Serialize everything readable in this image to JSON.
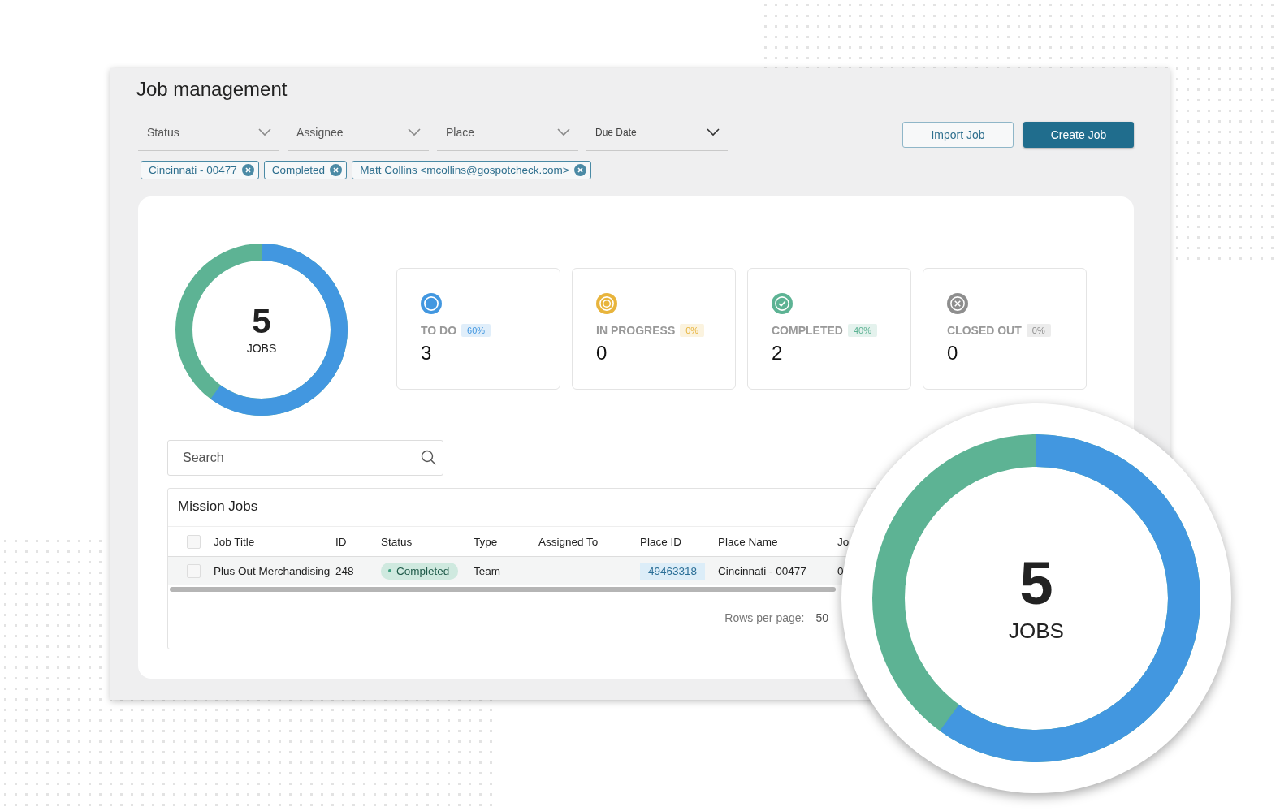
{
  "window": {
    "title": "Job management"
  },
  "filters": [
    {
      "label": "Status",
      "kind": "normal"
    },
    {
      "label": "Assignee",
      "kind": "normal"
    },
    {
      "label": "Place",
      "kind": "normal"
    },
    {
      "label": "Due Date",
      "kind": "small"
    }
  ],
  "buttons": [
    {
      "label": "Import Job",
      "kind": "secondary"
    },
    {
      "label": "Create Job",
      "kind": "primary"
    }
  ],
  "chips": [
    {
      "label": "Cincinnati - 00477"
    },
    {
      "label": "Completed"
    },
    {
      "label": "Matt Collins <mcollins@gospotcheck.com>"
    }
  ],
  "summary": {
    "total": "5",
    "unit": "JOBS",
    "level": 0.6
  },
  "stats": [
    {
      "kind": "todo",
      "label": "TO DO",
      "percent": "60%",
      "count": "3",
      "color": "#4297e0"
    },
    {
      "kind": "in_progress",
      "label": "IN PROGRESS",
      "percent": "0%",
      "count": "0",
      "color": "#e8b43c"
    },
    {
      "kind": "completed",
      "label": "COMPLETED",
      "percent": "40%",
      "count": "2",
      "color": "#5db394"
    },
    {
      "kind": "closed",
      "label": "CLOSED OUT",
      "percent": "0%",
      "count": "0",
      "color": "#8e8e8e"
    }
  ],
  "search": {
    "placeholder": "Search"
  },
  "table": {
    "title": "Mission Jobs",
    "select_all": {
      "checked": false
    },
    "columns": [
      "Job Title",
      "ID",
      "Status",
      "Type",
      "Assigned To",
      "Place ID",
      "Place Name",
      "Jo"
    ],
    "rows": [
      {
        "checked": false,
        "cells": [
          "Plus Out Merchandising",
          "248",
          "Completed",
          "Team",
          "",
          "49463318",
          "Cincinnati - 00477",
          "0"
        ]
      }
    ],
    "rows_per_page_label": "Rows per page:",
    "rows_per_page": "50"
  },
  "magnifier": {
    "total": "5",
    "unit": "JOBS",
    "level": 0.6
  }
}
